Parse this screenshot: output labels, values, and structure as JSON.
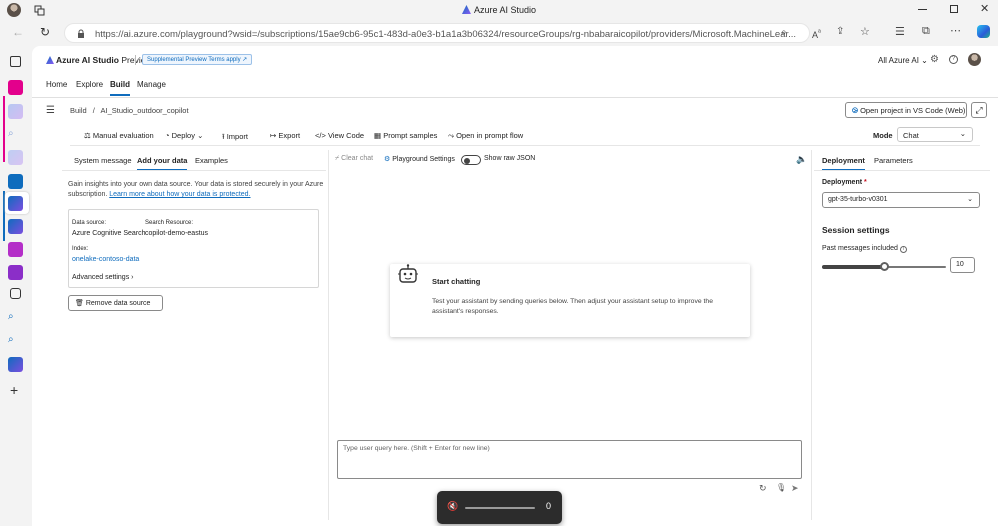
{
  "window": {
    "title": "Azure AI Studio"
  },
  "browser": {
    "url": "https://ai.azure.com/playground?wsid=/subscriptions/15ae9cb6-95c1-483d-a0e3-b1a1a3b06324/resourceGroups/rg-nbabaraicopilot/providers/Microsoft.MachineLear..."
  },
  "header": {
    "brand": "Azure AI Studio",
    "preview": "Preview",
    "terms": "Supplemental Preview Terms apply",
    "scope": "All Azure AI"
  },
  "nav": {
    "tabs": [
      "Home",
      "Explore",
      "Build",
      "Manage"
    ]
  },
  "breadcrumb": {
    "root": "Build",
    "sep": "/",
    "project": "AI_Studio_outdoor_copilot"
  },
  "open_vscode": "Open project in VS Code (Web)",
  "toolbar": {
    "manual_eval": "Manual evaluation",
    "deploy": "Deploy",
    "import": "Import",
    "export": "Export",
    "view_code": "View Code",
    "prompt_samples": "Prompt samples",
    "open_flow": "Open in prompt flow",
    "mode_label": "Mode",
    "mode_value": "Chat"
  },
  "setup": {
    "tabs": [
      "System message",
      "Add your data",
      "Examples"
    ],
    "intro": "Gain insights into your own data source. Your data is stored securely in your Azure subscription.",
    "learn_more": "Learn more about how your data is protected.",
    "data_source_label": "Data source:",
    "data_source_value": "Azure Cognitive Search",
    "search_resource_label": "Search Resource:",
    "search_resource_value": "copilot-demo-eastus",
    "index_label": "Index:",
    "index_value": "onelake-contoso-data",
    "advanced": "Advanced settings",
    "remove": "Remove data source"
  },
  "chat": {
    "clear": "Clear chat",
    "settings": "Playground Settings",
    "raw_json": "Show raw JSON",
    "start_title": "Start chatting",
    "start_desc": "Test your assistant by sending queries below. Then adjust your assistant setup to improve the assistant's responses.",
    "placeholder": "Type user query here. (Shift + Enter for new line)"
  },
  "config": {
    "tabs": [
      "Deployment",
      "Parameters"
    ],
    "deployment_label": "Deployment",
    "required": "*",
    "deployment_value": "gpt-35-turbo-v0301",
    "session_title": "Session settings",
    "past_label": "Past messages included",
    "past_value": "10",
    "past_fraction": 0.5
  },
  "volume": {
    "value": "0"
  },
  "colors": {
    "accent": "#0f6cbd"
  }
}
